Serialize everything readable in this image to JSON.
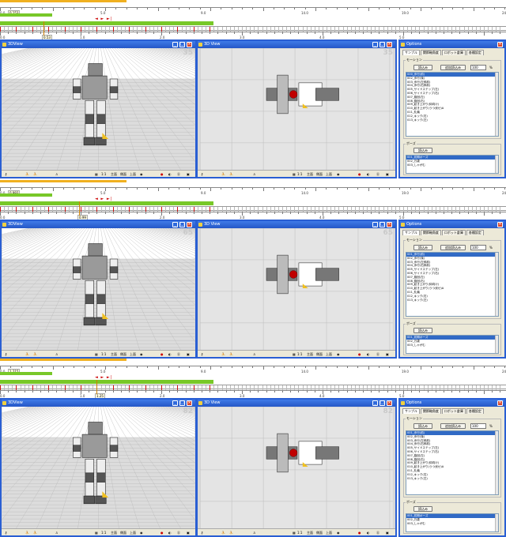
{
  "panels": [
    {
      "timeline": {
        "top_value": "0.153",
        "ruler_labels": [
          "0.0",
          "5.0",
          "9.0",
          "14.0",
          "19.0",
          "24.0"
        ],
        "bottom_value": "0.53",
        "bottom_labels": [
          "0.0",
          "1.0",
          "2.0",
          "3.0",
          "4.0",
          "5.0"
        ],
        "buttons": "◄ ► ►|"
      },
      "view3d": {
        "title": "3DView",
        "frame": "35"
      },
      "view3d2": {
        "title": "3D View",
        "frame": "35"
      },
      "options": {
        "title": "Options",
        "tabs": [
          "サンプル",
          "関節軸角度",
          "ロボット倉庫",
          "各種設定"
        ],
        "motion_label": "モーション",
        "read_btn": "読込み",
        "add_read_btn": "追加読込み",
        "spin_value": "100",
        "spin_unit": "%",
        "motions": [
          "000_歩行(前)",
          "002_歩行(後)",
          "003_歩行(左斜前)",
          "004_歩行(右斜前)",
          "005_サイドステップ(左)",
          "006_サイドステップ(右)",
          "007_旋回(左)",
          "008_旋回(右)",
          "009_起き上がり(仰向け)",
          "010_起き上がり(うつ伏せ)A",
          "011_礼儀",
          "012_キック(右)",
          "013_キック(左)"
        ],
        "pose_label": "ポーズ",
        "pose_read_btn": "読込み",
        "poses": [
          "001_初期ポーズ",
          "002_万歳",
          "003_しゃがむ"
        ]
      },
      "toolbar": {
        "left": "主面",
        "mid": "側面",
        "right": "上面",
        "ratio": "1:1"
      }
    },
    {
      "timeline": {
        "top_value": "0.993",
        "ruler_labels": [
          "0.0",
          "5.0",
          "9.0",
          "14.0",
          "19.0",
          "24.0"
        ],
        "bottom_value": "0.99",
        "bottom_labels": [
          "0.0",
          "1.0",
          "2.0",
          "3.0",
          "4.0",
          "5.0"
        ],
        "buttons": "◄ ► ►|"
      },
      "view3d": {
        "title": "3DView",
        "frame": "65"
      },
      "view3d2": {
        "title": "3D View",
        "frame": "65"
      },
      "options": {
        "title": "Options",
        "tabs": [
          "サンプル",
          "関節軸角度",
          "ロボット倉庫",
          "各種設定"
        ],
        "motion_label": "モーション",
        "read_btn": "読込み",
        "add_read_btn": "追加読込み",
        "spin_value": "100",
        "spin_unit": "%",
        "motions": [
          "001_歩行(前)",
          "002_歩行(後)",
          "003_歩行(左斜前)",
          "004_歩行(右斜前)",
          "005_サイドステップ(左)",
          "006_サイドステップ(右)",
          "007_旋回(左)",
          "008_旋回(右)",
          "009_起き上がり(仰向け)",
          "010_起き上がり(うつ伏せ)A",
          "011_礼儀",
          "012_キック(右)",
          "013_キック(左)"
        ],
        "pose_label": "ポーズ",
        "pose_read_btn": "読込み",
        "poses": [
          "001_初期ポーズ",
          "002_万歳",
          "003_しゃがむ"
        ]
      },
      "toolbar": {
        "left": "主面",
        "mid": "側面",
        "right": "上面",
        "ratio": "1:1"
      }
    },
    {
      "timeline": {
        "top_value": "1.215",
        "ruler_labels": [
          "0.0",
          "5.0",
          "9.0",
          "14.0",
          "19.0",
          "24.0"
        ],
        "bottom_value": "1.25",
        "bottom_labels": [
          "0.0",
          "1.0",
          "2.0",
          "3.0",
          "4.0",
          "5.0"
        ],
        "buttons": "◄ ► ►|"
      },
      "view3d": {
        "title": "3DView",
        "frame": "82"
      },
      "view3d2": {
        "title": "3D View",
        "frame": "82"
      },
      "options": {
        "title": "Options",
        "tabs": [
          "サンプル",
          "関節軸角度",
          "ロボット倉庫",
          "各種設定"
        ],
        "motion_label": "モーション",
        "read_btn": "読込み",
        "add_read_btn": "追加読込み",
        "spin_value": "100",
        "spin_unit": "%",
        "motions": [
          "001_歩行(前)",
          "002_歩行(後)",
          "003_歩行(左斜前)",
          "004_歩行(右斜前)",
          "005_サイドステップ(左)",
          "006_サイドステップ(右)",
          "007_旋回(左)",
          "008_旋回(右)",
          "009_起き上がり(仰向け)",
          "010_起き上がり(うつ伏せ)A",
          "011_礼儀",
          "012_キック(右)",
          "013_キック(左)"
        ],
        "pose_label": "ポーズ",
        "pose_read_btn": "読込み",
        "poses": [
          "001_初期ポーズ",
          "002_万歳",
          "003_しゃがむ"
        ]
      },
      "toolbar": {
        "left": "主面",
        "mid": "側面",
        "right": "上面",
        "ratio": "1:1"
      }
    }
  ],
  "colors": {
    "accent": "#2a5fd3",
    "timeline_green": "#78c828",
    "timeline_orange": "#f0b020",
    "marker_red": "#d01010"
  }
}
